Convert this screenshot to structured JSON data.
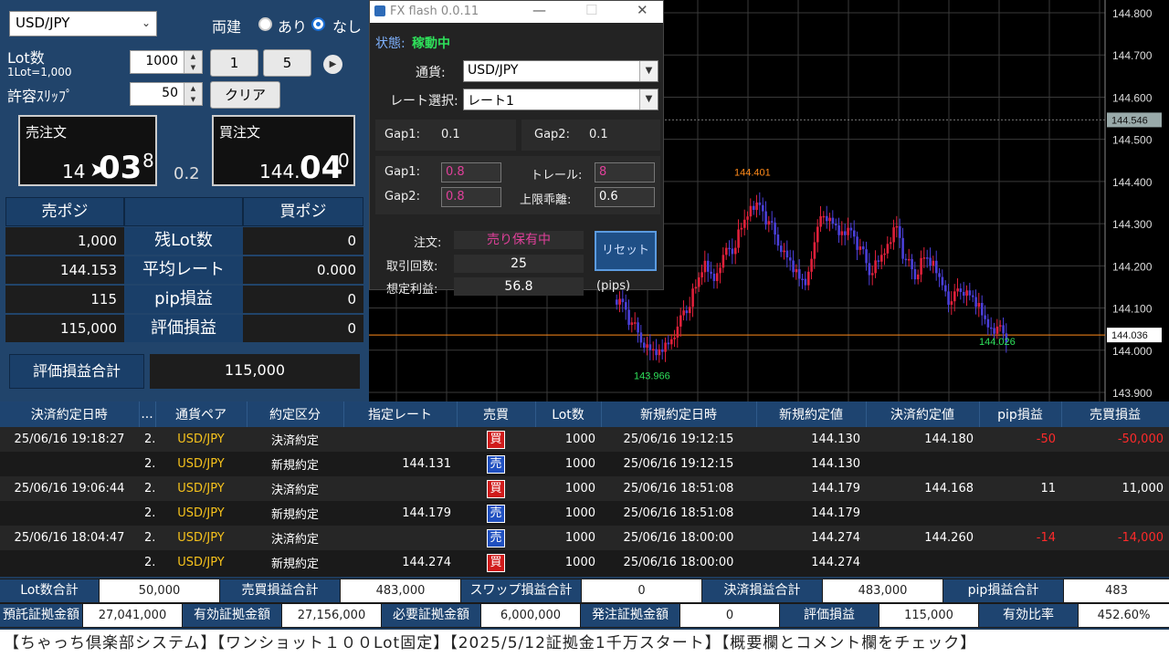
{
  "left": {
    "pair_select": "USD/JPY",
    "hedge_label": "両建",
    "hedge_yes": "あり",
    "hedge_no": "なし",
    "lot_label": "Lot数",
    "lot_sub": "1Lot=1,000",
    "lot_value": "1000",
    "btn_1": "1",
    "btn_5": "5",
    "slip_label": "許容ｽﾘｯﾌﾟ",
    "slip_value": "50",
    "clear_btn": "クリア",
    "sell_title": "売注文",
    "sell_small": "14",
    "sell_big": "03",
    "sell_sup": "8",
    "spread": "0.2",
    "buy_title": "買注文",
    "buy_small": "144.",
    "buy_big": "04",
    "buy_sup": "0",
    "sell_pos_hdr": "売ポジ",
    "buy_pos_hdr": "買ポジ",
    "rows": [
      {
        "sell": "1,000",
        "label": "残Lot数",
        "buy": "0"
      },
      {
        "sell": "144.153",
        "label": "平均レート",
        "buy": "0.000"
      },
      {
        "sell": "115",
        "label": "pip損益",
        "buy": "0"
      },
      {
        "sell": "115,000",
        "label": "評価損益",
        "buy": "0"
      }
    ],
    "total_label": "評価損益合計",
    "total_value": "115,000"
  },
  "fx": {
    "title": "FX flash 0.0.11",
    "status_label": "状態:",
    "status_value": "稼動中",
    "pair_label": "通貨:",
    "pair_value": "USD/JPY",
    "rate_label": "レート選択:",
    "rate_value": "レート1",
    "gap1_label": "Gap1:",
    "gap1_value": "0.1",
    "gap2_label": "Gap2:",
    "gap2_value": "0.1",
    "gap1b_label": "Gap1:",
    "gap1b_value": "0.8",
    "trail_label": "トレール:",
    "trail_value": "8",
    "gap2b_label": "Gap2:",
    "gap2b_value": "0.8",
    "limit_label": "上限乖離:",
    "limit_value": "0.6",
    "order_label": "注文:",
    "order_value": "売り保有中",
    "reset_btn": "リセット",
    "count_label": "取引回数:",
    "count_value": "25",
    "profit_label": "想定利益:",
    "profit_value": "56.8",
    "profit_unit": "(pips)"
  },
  "chart_data": {
    "type": "candlestick",
    "y_ticks": [
      "144.800",
      "144.700",
      "144.600",
      "144.500",
      "144.400",
      "144.300",
      "144.200",
      "144.100",
      "144.000",
      "143.900"
    ],
    "current_price": "144.546",
    "line_price": "144.036",
    "annotations": {
      "high": "144.401",
      "low": "143.966",
      "last": "144.026"
    },
    "colors": {
      "up": "#e0203a",
      "down": "#4a3fd8",
      "orange": "#ff8a1a",
      "green": "#2ee05a"
    }
  },
  "trades": {
    "headers": [
      "決済約定日時",
      "...",
      "通貨ペア",
      "約定区分",
      "指定レート",
      "売買",
      "Lot数",
      "新規約定日時",
      "新規約定値",
      "決済約定値",
      "pip損益",
      "売買損益"
    ],
    "rows": [
      {
        "close_time": "25/06/16 19:18:27",
        "id": "2...",
        "pair": "USD/JPY",
        "type": "決済約定",
        "rate": "",
        "side": "買",
        "side_cls": "buy",
        "lot": "1000",
        "open_time": "25/06/16 19:12:15",
        "open": "144.130",
        "close": "144.180",
        "pip": "-50",
        "pl": "-50,000",
        "neg": true
      },
      {
        "close_time": "",
        "id": "2...",
        "pair": "USD/JPY",
        "type": "新規約定",
        "rate": "144.131",
        "side": "売",
        "side_cls": "sell",
        "lot": "1000",
        "open_time": "25/06/16 19:12:15",
        "open": "144.130",
        "close": "",
        "pip": "",
        "pl": "",
        "neg": false
      },
      {
        "close_time": "25/06/16 19:06:44",
        "id": "2...",
        "pair": "USD/JPY",
        "type": "決済約定",
        "rate": "",
        "side": "買",
        "side_cls": "buy",
        "lot": "1000",
        "open_time": "25/06/16 18:51:08",
        "open": "144.179",
        "close": "144.168",
        "pip": "11",
        "pl": "11,000",
        "neg": false
      },
      {
        "close_time": "",
        "id": "2...",
        "pair": "USD/JPY",
        "type": "新規約定",
        "rate": "144.179",
        "side": "売",
        "side_cls": "sell",
        "lot": "1000",
        "open_time": "25/06/16 18:51:08",
        "open": "144.179",
        "close": "",
        "pip": "",
        "pl": "",
        "neg": false
      },
      {
        "close_time": "25/06/16 18:04:47",
        "id": "2...",
        "pair": "USD/JPY",
        "type": "決済約定",
        "rate": "",
        "side": "売",
        "side_cls": "sell",
        "lot": "1000",
        "open_time": "25/06/16 18:00:00",
        "open": "144.274",
        "close": "144.260",
        "pip": "-14",
        "pl": "-14,000",
        "neg": true
      },
      {
        "close_time": "",
        "id": "2...",
        "pair": "USD/JPY",
        "type": "新規約定",
        "rate": "144.274",
        "side": "買",
        "side_cls": "buy",
        "lot": "1000",
        "open_time": "25/06/16 18:00:00",
        "open": "144.274",
        "close": "",
        "pip": "",
        "pl": "",
        "neg": false
      }
    ]
  },
  "summary1": [
    {
      "label": "Lot数合計",
      "value": "50,000"
    },
    {
      "label": "売買損益合計",
      "value": "483,000"
    },
    {
      "label": "スワップ損益合計",
      "value": "0"
    },
    {
      "label": "決済損益合計",
      "value": "483,000"
    },
    {
      "label": "pip損益合計",
      "value": "483"
    }
  ],
  "summary2": [
    {
      "label": "預託証拠金額",
      "value": "27,041,000"
    },
    {
      "label": "有効証拠金額",
      "value": "27,156,000"
    },
    {
      "label": "必要証拠金額",
      "value": "6,000,000"
    },
    {
      "label": "発注証拠金額",
      "value": "0"
    },
    {
      "label": "評価損益",
      "value": "115,000"
    },
    {
      "label": "有効比率",
      "value": "452.60%"
    }
  ],
  "banner": "【ちゃっち倶楽部システム】【ワンショット１００Lot固定】【2025/5/12証拠金1千万スタート】【概要欄とコメント欄をチェック】"
}
